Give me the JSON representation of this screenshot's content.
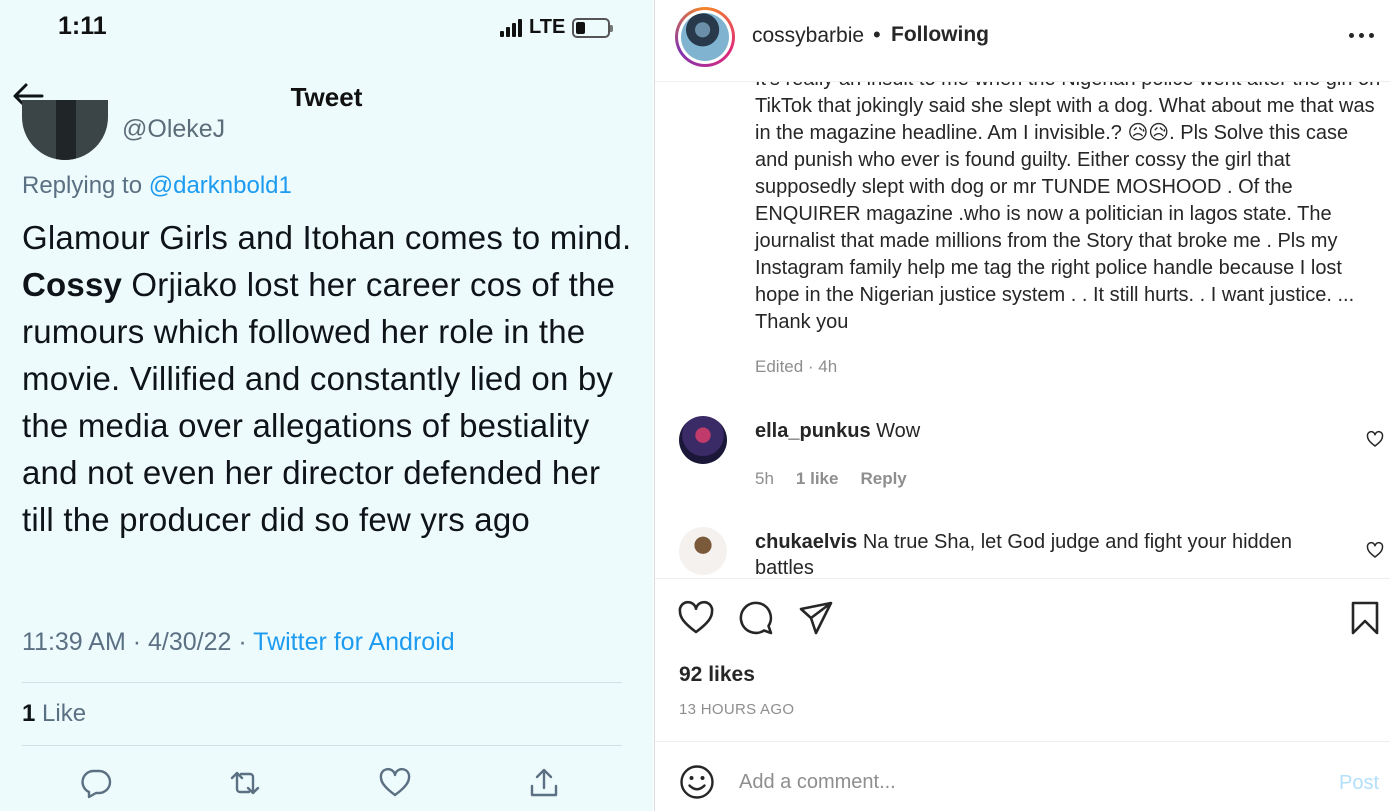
{
  "tweet_screen": {
    "status_bar": {
      "time": "1:11",
      "network": "LTE"
    },
    "header_title": "Tweet",
    "partial_handle": "@OlekeJ",
    "replying_prefix": "Replying to ",
    "replying_mention": "@darknbold1",
    "body_before": "Glamour Girls and Itohan comes to mind. ",
    "body_bold": "Cossy",
    "body_after": " Orjiako lost her career cos of the rumours which followed her role in the movie. Villified and constantly lied on by the media over allegations of bestiality and not even her director defended her till the producer did so few yrs ago",
    "timestamp": "11:39 AM · 4/30/22 · ",
    "source": "Twitter for Android",
    "likes_count": "1",
    "likes_label": " Like",
    "actions": [
      "reply-icon",
      "retweet-icon",
      "like-icon",
      "share-icon"
    ]
  },
  "instagram": {
    "username": "cossybarbie",
    "separator": "•",
    "follow_status": "Following",
    "caption": "It's really an insult to me when the Nigerian police went after the girl on TikTok that jokingly said she slept with a dog. What about me that was in the magazine headline. Am I invisible.? 😥😥. Pls Solve this case and punish who ever is found guilty. Either cossy the girl that supposedly slept with dog or mr TUNDE MOSHOOD . Of the ENQUIRER magazine .who is now a politician in lagos state. The journalist that made millions from the Story that broke me . Pls my Instagram family help me tag the right police handle because I lost hope in the Nigerian justice system . . It still hurts. . I want justice. ... Thank you",
    "edited": "Edited · 4h",
    "comments": [
      {
        "user": "ella_punkus",
        "text": " Wow",
        "time": "5h",
        "likes": "1 like",
        "reply": "Reply"
      },
      {
        "user": "chukaelvis",
        "text": " Na true Sha, let God judge and fight your hidden battles"
      }
    ],
    "likes": "92 likes",
    "posted": "13 HOURS AGO",
    "comment_placeholder": "Add a comment...",
    "post_label": "Post",
    "colors": {
      "link": "#1d9bf0",
      "post_disabled": "#b2dffc",
      "muted": "#8e8e8e"
    }
  }
}
